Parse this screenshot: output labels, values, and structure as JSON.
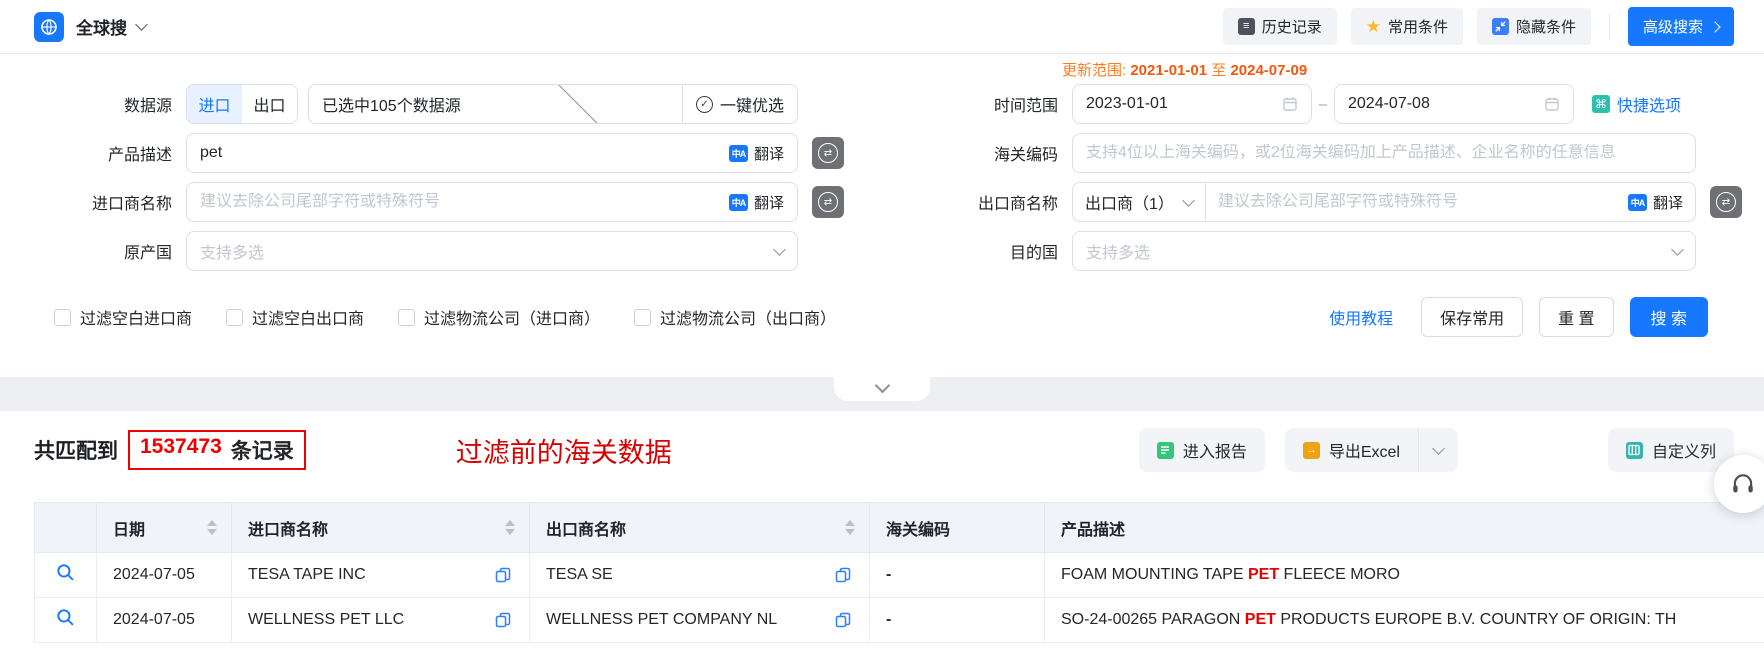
{
  "topbar": {
    "app_title": "全球搜",
    "history_btn": "历史记录",
    "favorite_btn": "常用条件",
    "hide_btn": "隐藏条件",
    "advanced_btn": "高级搜索"
  },
  "form": {
    "update_range": {
      "label": "更新范围:",
      "from": "2021-01-01",
      "to_word": "至",
      "to": "2024-07-09"
    },
    "data_source": {
      "label": "数据源",
      "tab_import": "进口",
      "tab_export": "出口",
      "selected": "已选中105个数据源",
      "optimize": "一键优选"
    },
    "time_range": {
      "label": "时间范围",
      "start": "2023-01-01",
      "sep": "–",
      "end": "2024-07-08",
      "quick": "快捷选项"
    },
    "product_desc": {
      "label": "产品描述",
      "value": "pet",
      "translate": "翻译"
    },
    "hs_code": {
      "label": "海关编码",
      "placeholder": "支持4位以上海关编码，或2位海关编码加上产品描述、企业名称的任意信息"
    },
    "importer": {
      "label": "进口商名称",
      "placeholder": "建议去除公司尾部字符或特殊符号",
      "translate": "翻译"
    },
    "exporter": {
      "label": "出口商名称",
      "type_selected": "出口商（1）",
      "placeholder": "建议去除公司尾部字符或特殊符号",
      "translate": "翻译"
    },
    "origin_country": {
      "label": "原产国",
      "placeholder": "支持多选"
    },
    "dest_country": {
      "label": "目的国",
      "placeholder": "支持多选"
    },
    "checkboxes": [
      "过滤空白进口商",
      "过滤空白出口商",
      "过滤物流公司（进口商）",
      "过滤物流公司（出口商）"
    ],
    "tutorial_link": "使用教程",
    "save_btn": "保存常用",
    "reset_btn": "重 置",
    "search_btn": "搜 索"
  },
  "results": {
    "prefix": "共匹配到",
    "count": "1537473",
    "suffix": "条记录",
    "annotation": "过滤前的海关数据",
    "report_btn": "进入报告",
    "export_btn": "导出Excel",
    "custom_col_btn": "自定义列"
  },
  "table": {
    "headers": [
      "日期",
      "进口商名称",
      "出口商名称",
      "海关编码",
      "产品描述"
    ],
    "rows": [
      {
        "date": "2024-07-05",
        "importer": "TESA TAPE INC",
        "exporter": "TESA SE",
        "hs_code": "-",
        "desc_pre": "FOAM MOUNTING TAPE ",
        "desc_hl": "PET",
        "desc_post": " FLEECE MORO"
      },
      {
        "date": "2024-07-05",
        "importer": "WELLNESS PET LLC",
        "exporter": "WELLNESS PET COMPANY NL",
        "hs_code": "-",
        "desc_pre": "SO-24-00265 PARAGON ",
        "desc_hl": "PET",
        "desc_post": " PRODUCTS EUROPE B.V. COUNTRY OF ORIGIN: TH"
      }
    ]
  },
  "icons": {
    "translate": "中A",
    "star": "★",
    "check": "✓",
    "command": "⌘",
    "swap": "⇄",
    "menu": "≡",
    "arrow": "→"
  },
  "colors": {
    "accent_blue": "#1677ff",
    "orange": "#f4570f",
    "red": "#e80000",
    "teal": "#2ebfae"
  }
}
